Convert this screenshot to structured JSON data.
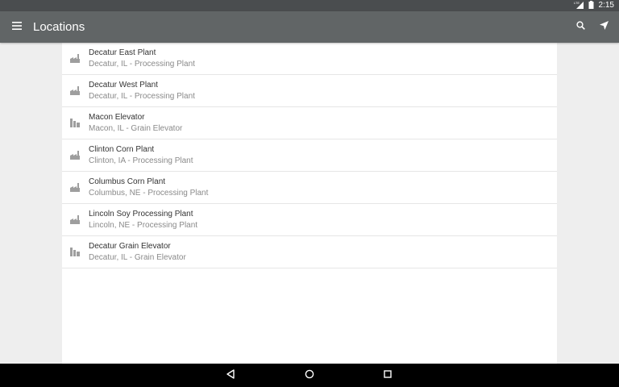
{
  "status_bar": {
    "time": "2:15",
    "network_badge": "LTE",
    "icons": [
      "signal-icon",
      "battery-icon"
    ]
  },
  "app_bar": {
    "title": "Locations",
    "icons": [
      "menu-icon",
      "search-icon",
      "navigation-arrow-icon"
    ]
  },
  "locations": [
    {
      "name": "Decatur East Plant",
      "detail": "Decatur, IL - Processing Plant",
      "icon": "factory-icon"
    },
    {
      "name": "Decatur West Plant",
      "detail": "Decatur, IL - Processing Plant",
      "icon": "factory-icon"
    },
    {
      "name": "Macon Elevator",
      "detail": "Macon, IL - Grain Elevator",
      "icon": "grain-elevator-icon"
    },
    {
      "name": "Clinton Corn Plant",
      "detail": "Clinton, IA - Processing Plant",
      "icon": "factory-icon"
    },
    {
      "name": "Columbus Corn Plant",
      "detail": "Columbus, NE - Processing Plant",
      "icon": "factory-icon"
    },
    {
      "name": "Lincoln Soy Processing Plant",
      "detail": "Lincoln, NE - Processing Plant",
      "icon": "factory-icon"
    },
    {
      "name": "Decatur Grain Elevator",
      "detail": "Decatur, IL - Grain Elevator",
      "icon": "grain-elevator-icon"
    }
  ],
  "colors": {
    "app_bar": "#616566",
    "status_bar": "#4a4d4f",
    "page_background": "#eeeeee",
    "list_background": "#ffffff",
    "icon_gray": "#9e9e9e"
  },
  "nav_bar": {
    "icons": [
      "back-icon",
      "home-icon",
      "recents-icon"
    ]
  }
}
